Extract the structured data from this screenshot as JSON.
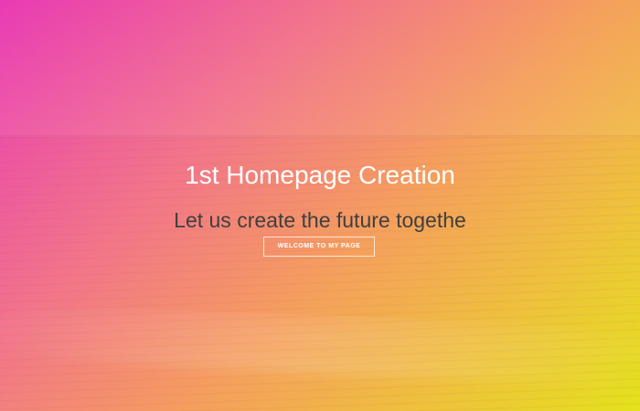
{
  "hero": {
    "title": "1st Homepage Creation",
    "subtitle": "Let us create the future togethe",
    "cta_label": "WELCOME TO MY PAGE"
  },
  "colors": {
    "gradient_start": "#e93ab4",
    "gradient_mid": "#f5a05c",
    "gradient_end": "#e4e21c",
    "title_text": "#ffffff",
    "subtitle_text": "#3f3f3f"
  }
}
